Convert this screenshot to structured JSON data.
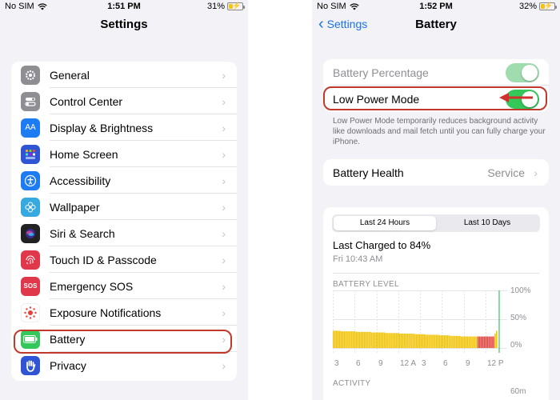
{
  "left": {
    "status": {
      "carrier": "No SIM",
      "time": "1:51 PM",
      "battery": "31%",
      "battery_level": 0.31
    },
    "title": "Settings",
    "items": [
      {
        "label": "General",
        "icon": "gear-icon",
        "color": "#8e8e93"
      },
      {
        "label": "Control Center",
        "icon": "switches-icon",
        "color": "#8e8e93"
      },
      {
        "label": "Display & Brightness",
        "icon": "text-size-icon",
        "color": "#1e7cf2",
        "glyph": "AA"
      },
      {
        "label": "Home Screen",
        "icon": "home-grid-icon",
        "color": "#2f55d4"
      },
      {
        "label": "Accessibility",
        "icon": "accessibility-icon",
        "color": "#1e7cf2"
      },
      {
        "label": "Wallpaper",
        "icon": "flower-icon",
        "color": "#36a9e1"
      },
      {
        "label": "Siri & Search",
        "icon": "siri-icon",
        "color": "#222"
      },
      {
        "label": "Touch ID & Passcode",
        "icon": "fingerprint-icon",
        "color": "#e0384a"
      },
      {
        "label": "Emergency SOS",
        "icon": "sos-icon",
        "color": "#e0384a",
        "glyph": "SOS"
      },
      {
        "label": "Exposure Notifications",
        "icon": "exposure-icon",
        "color": "#ffffff"
      },
      {
        "label": "Battery",
        "icon": "battery-icon",
        "color": "#34c759"
      },
      {
        "label": "Privacy",
        "icon": "hand-icon",
        "color": "#2f55d4"
      }
    ]
  },
  "right": {
    "status": {
      "carrier": "No SIM",
      "time": "1:52 PM",
      "battery": "32%",
      "battery_level": 0.32
    },
    "back_label": "Settings",
    "title": "Battery",
    "battery_percentage_label": "Battery Percentage",
    "low_power_label": "Low Power Mode",
    "low_power_note": "Low Power Mode temporarily reduces background activity like downloads and mail fetch until you can fully charge your iPhone.",
    "health_label": "Battery Health",
    "health_value": "Service",
    "segments": [
      "Last 24 Hours",
      "Last 10 Days"
    ],
    "last_charged": "Last Charged to 84%",
    "last_charged_time": "Fri 10:43 AM",
    "activity_label": "ACTIVITY",
    "activity_tick": "60m"
  },
  "chart_data": {
    "type": "bar",
    "title": "BATTERY LEVEL",
    "y_ticks": [
      "100%",
      "50%",
      "0%"
    ],
    "ylim": [
      0,
      100
    ],
    "x_ticks": [
      "3",
      "6",
      "9",
      "12 A",
      "3",
      "6",
      "9",
      "12 P"
    ],
    "values": [
      30,
      30,
      30,
      30,
      30,
      29,
      29,
      29,
      29,
      29,
      29,
      29,
      29,
      29,
      29,
      28,
      28,
      28,
      28,
      28,
      28,
      28,
      28,
      28,
      28,
      27,
      27,
      27,
      27,
      27,
      27,
      27,
      27,
      27,
      26,
      26,
      26,
      26,
      26,
      26,
      26,
      26,
      26,
      25,
      25,
      25,
      25,
      25,
      25,
      25,
      25,
      25,
      25,
      24,
      24,
      24,
      24,
      24,
      24,
      24,
      23,
      23,
      23,
      23,
      23,
      23,
      23,
      23,
      23,
      22,
      22,
      22,
      22,
      22,
      22,
      22,
      21,
      21,
      21,
      21,
      21,
      21,
      21,
      20,
      20,
      20,
      20,
      20,
      20,
      20,
      20,
      20,
      20,
      20,
      20,
      20,
      20,
      20,
      20,
      20,
      20,
      20,
      20,
      20,
      20,
      25,
      30
    ],
    "low_power_start_index": 94,
    "colors": {
      "normal": "#f2c200",
      "low": "#e8403a",
      "charge": "#34c759"
    }
  }
}
